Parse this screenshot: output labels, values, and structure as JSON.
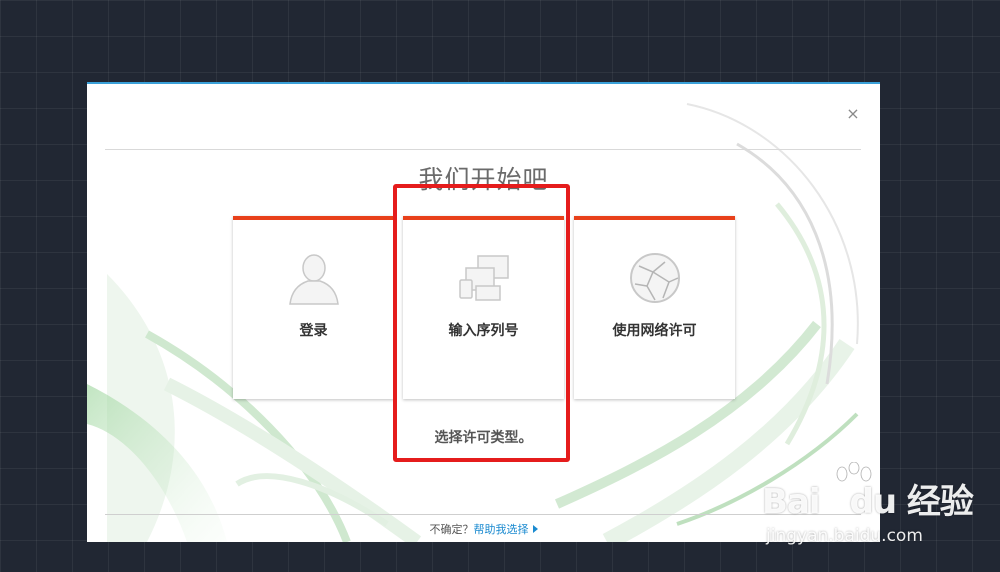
{
  "dialog": {
    "title": "我们开始吧",
    "close_symbol": "×",
    "subtitle": "选择许可类型。",
    "accent_color": "#e8401a",
    "top_border_color": "#3aa0d8"
  },
  "cards": [
    {
      "label": "登录",
      "icon": "user-icon"
    },
    {
      "label": "输入序列号",
      "icon": "devices-icon"
    },
    {
      "label": "使用网络许可",
      "icon": "network-globe-icon"
    }
  ],
  "footer": {
    "prefix": "不确定？",
    "help_link": "帮助我选择"
  },
  "annotation": {
    "highlight_color": "#e51c1c"
  },
  "watermark": {
    "brand": "Bai",
    "brand_suffix": "du",
    "product": "经验",
    "url": "jingyan.baidu.com"
  }
}
